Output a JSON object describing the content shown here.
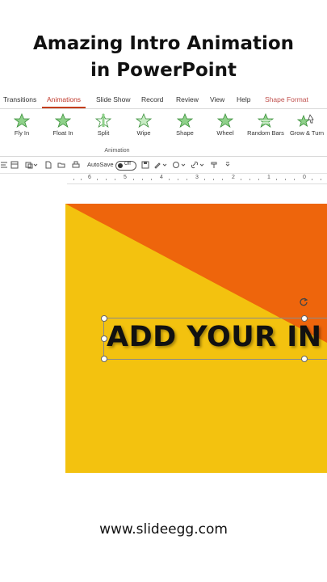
{
  "headline": {
    "line1": "Amazing Intro Animation",
    "line2": "in PowerPoint"
  },
  "ribbon": {
    "tabs": [
      "Transitions",
      "Animations",
      "Slide Show",
      "Record",
      "Review",
      "View",
      "Help",
      "Shape Format"
    ],
    "active_tab": "Animations",
    "effects": [
      "Fly In",
      "Float In",
      "Split",
      "Wipe",
      "Shape",
      "Wheel",
      "Random Bars",
      "Grow & Turn"
    ],
    "group_label": "Animation"
  },
  "qat": {
    "autosave_label": "AutoSave",
    "toggle_state": "Off"
  },
  "ruler": {
    "numbers": [
      "6",
      "5",
      "4",
      "3",
      "2",
      "1",
      "0"
    ]
  },
  "slide": {
    "text": "ADD YOUR IN",
    "colors": {
      "background": "#f3c20f",
      "triangle": "#ee650c",
      "text": "#111111"
    }
  },
  "footer": {
    "url": "www.slideegg.com"
  },
  "colors": {
    "accent": "#c43e1c",
    "star_fill": "#8fd18a",
    "star_stroke": "#3a8f3a"
  }
}
